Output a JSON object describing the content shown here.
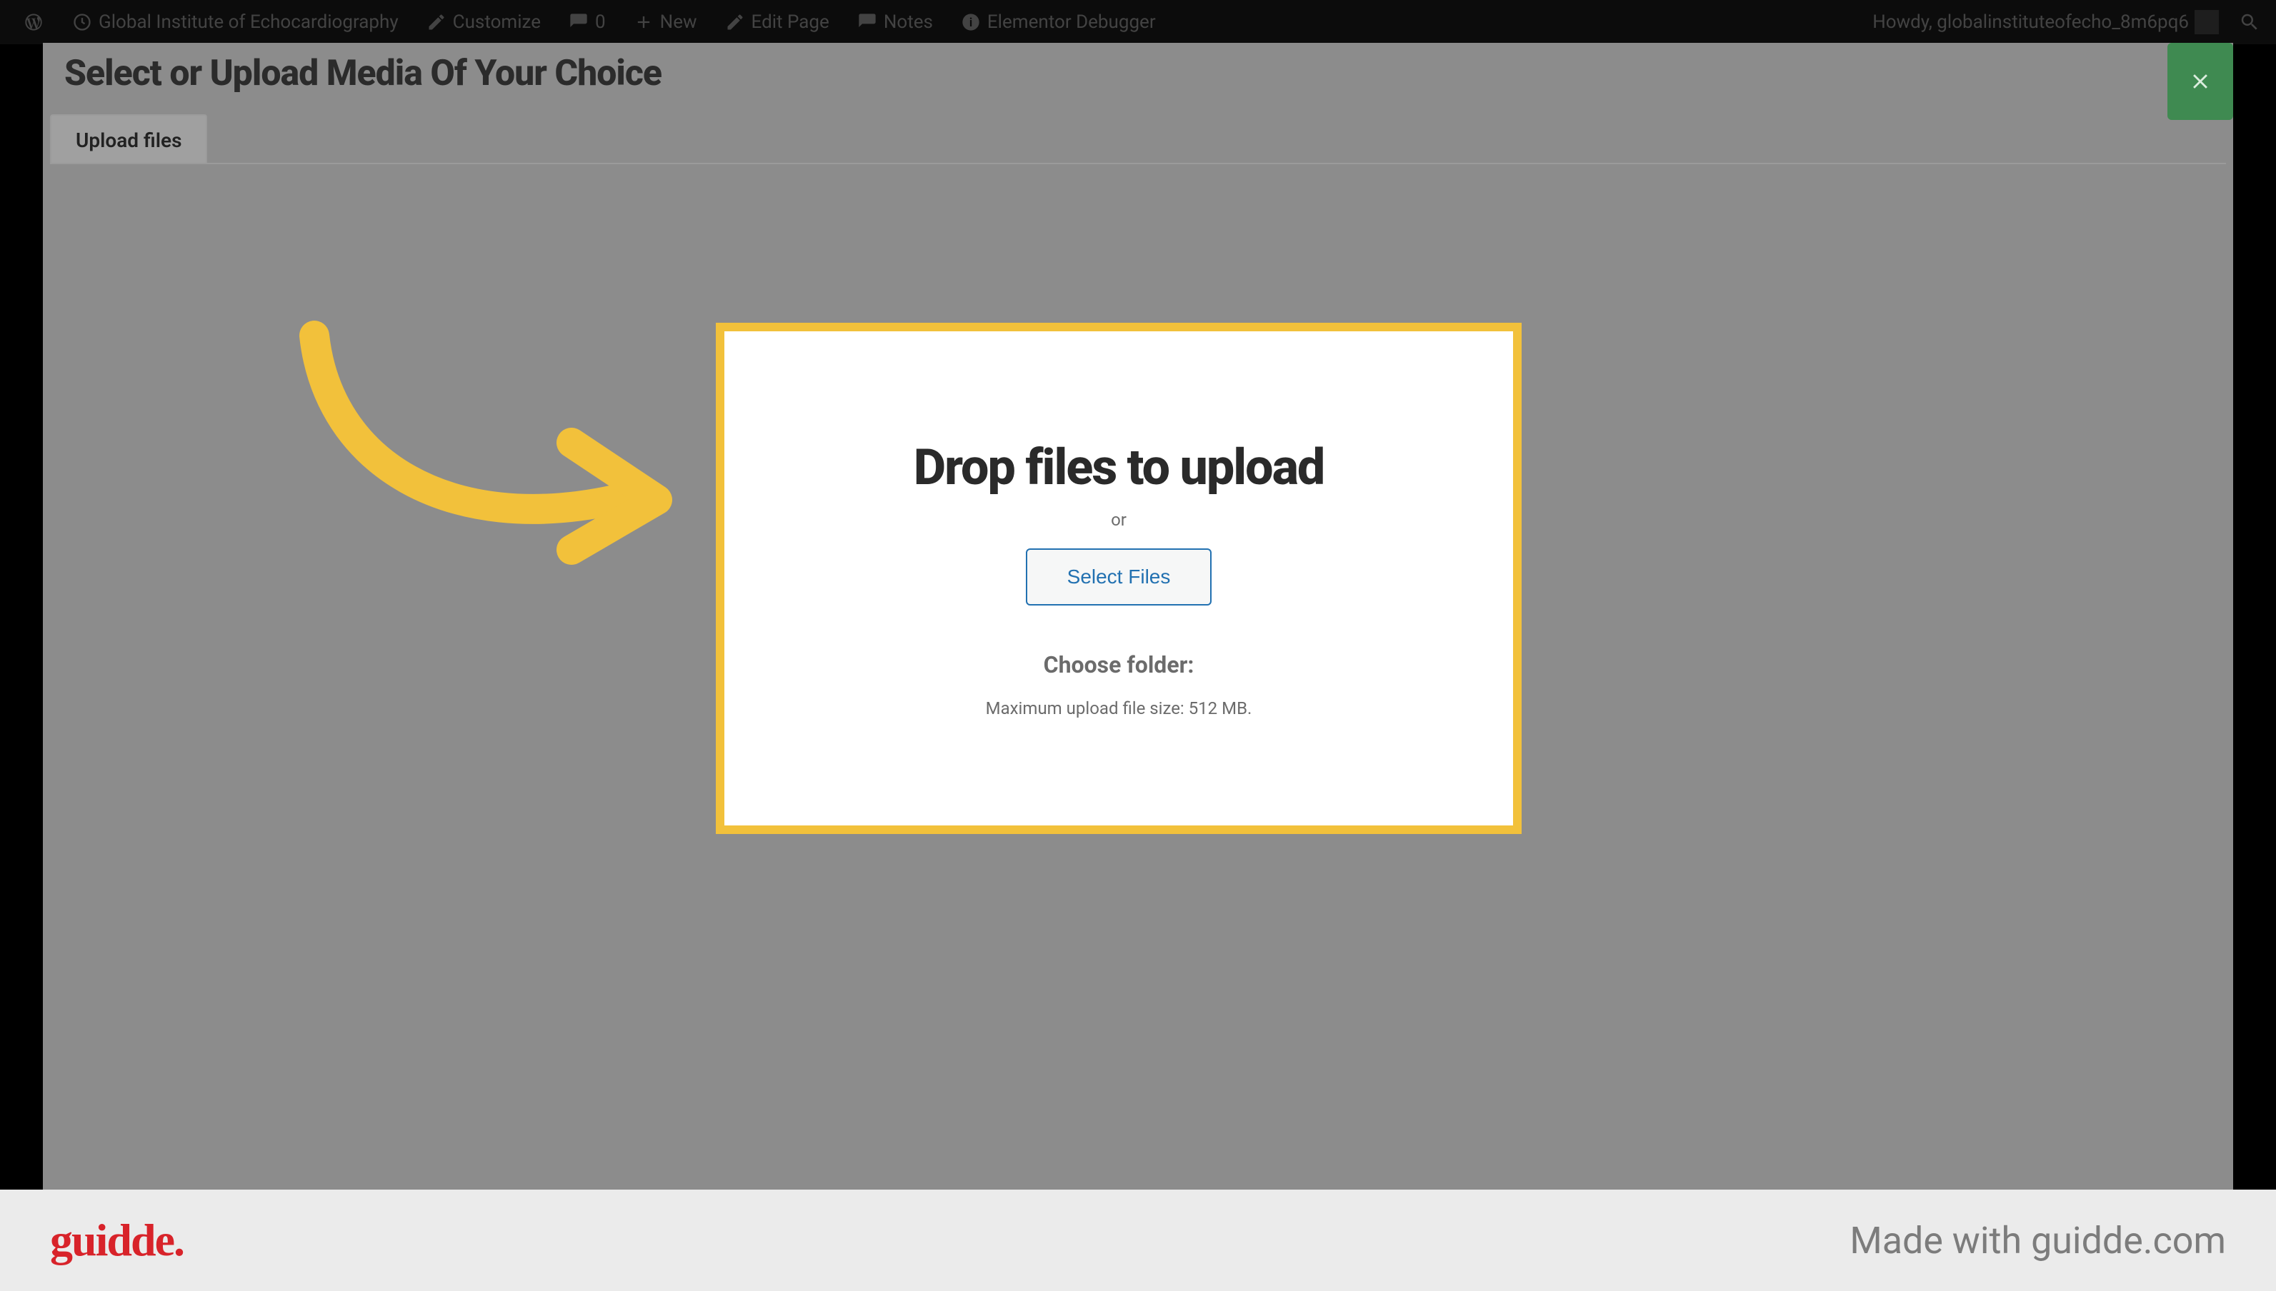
{
  "admin_bar": {
    "site_name": "Global Institute of Echocardiography",
    "customize": "Customize",
    "comment_count": "0",
    "new_label": "New",
    "edit_page": "Edit Page",
    "notes": "Notes",
    "debugger": "Elementor Debugger",
    "howdy": "Howdy, globalinstituteofecho_8m6pq6"
  },
  "modal": {
    "title": "Select or Upload Media Of Your Choice",
    "tabs": {
      "upload_files": "Upload files"
    },
    "upload_card": {
      "headline": "Drop files to upload",
      "or": "or",
      "select_button": "Select Files",
      "choose_folder": "Choose folder:",
      "max_size": "Maximum upload file size: 512 MB."
    }
  },
  "footer": {
    "logo_text": "guidde.",
    "credit": "Made with guidde.com"
  },
  "annotation": {
    "arrow_color": "#f2c13b",
    "highlight_border_color": "#f2c13b"
  }
}
